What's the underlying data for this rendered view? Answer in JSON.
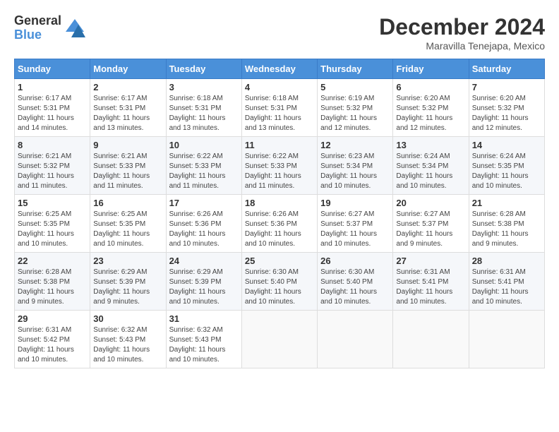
{
  "logo": {
    "general": "General",
    "blue": "Blue"
  },
  "title": {
    "month_year": "December 2024",
    "location": "Maravilla Tenejapa, Mexico"
  },
  "weekdays": [
    "Sunday",
    "Monday",
    "Tuesday",
    "Wednesday",
    "Thursday",
    "Friday",
    "Saturday"
  ],
  "weeks": [
    [
      {
        "day": "1",
        "sunrise": "6:17 AM",
        "sunset": "5:31 PM",
        "daylight": "11 hours and 14 minutes."
      },
      {
        "day": "2",
        "sunrise": "6:17 AM",
        "sunset": "5:31 PM",
        "daylight": "11 hours and 13 minutes."
      },
      {
        "day": "3",
        "sunrise": "6:18 AM",
        "sunset": "5:31 PM",
        "daylight": "11 hours and 13 minutes."
      },
      {
        "day": "4",
        "sunrise": "6:18 AM",
        "sunset": "5:31 PM",
        "daylight": "11 hours and 13 minutes."
      },
      {
        "day": "5",
        "sunrise": "6:19 AM",
        "sunset": "5:32 PM",
        "daylight": "11 hours and 12 minutes."
      },
      {
        "day": "6",
        "sunrise": "6:20 AM",
        "sunset": "5:32 PM",
        "daylight": "11 hours and 12 minutes."
      },
      {
        "day": "7",
        "sunrise": "6:20 AM",
        "sunset": "5:32 PM",
        "daylight": "11 hours and 12 minutes."
      }
    ],
    [
      {
        "day": "8",
        "sunrise": "6:21 AM",
        "sunset": "5:32 PM",
        "daylight": "11 hours and 11 minutes."
      },
      {
        "day": "9",
        "sunrise": "6:21 AM",
        "sunset": "5:33 PM",
        "daylight": "11 hours and 11 minutes."
      },
      {
        "day": "10",
        "sunrise": "6:22 AM",
        "sunset": "5:33 PM",
        "daylight": "11 hours and 11 minutes."
      },
      {
        "day": "11",
        "sunrise": "6:22 AM",
        "sunset": "5:33 PM",
        "daylight": "11 hours and 11 minutes."
      },
      {
        "day": "12",
        "sunrise": "6:23 AM",
        "sunset": "5:34 PM",
        "daylight": "11 hours and 10 minutes."
      },
      {
        "day": "13",
        "sunrise": "6:24 AM",
        "sunset": "5:34 PM",
        "daylight": "11 hours and 10 minutes."
      },
      {
        "day": "14",
        "sunrise": "6:24 AM",
        "sunset": "5:35 PM",
        "daylight": "11 hours and 10 minutes."
      }
    ],
    [
      {
        "day": "15",
        "sunrise": "6:25 AM",
        "sunset": "5:35 PM",
        "daylight": "11 hours and 10 minutes."
      },
      {
        "day": "16",
        "sunrise": "6:25 AM",
        "sunset": "5:35 PM",
        "daylight": "11 hours and 10 minutes."
      },
      {
        "day": "17",
        "sunrise": "6:26 AM",
        "sunset": "5:36 PM",
        "daylight": "11 hours and 10 minutes."
      },
      {
        "day": "18",
        "sunrise": "6:26 AM",
        "sunset": "5:36 PM",
        "daylight": "11 hours and 10 minutes."
      },
      {
        "day": "19",
        "sunrise": "6:27 AM",
        "sunset": "5:37 PM",
        "daylight": "11 hours and 10 minutes."
      },
      {
        "day": "20",
        "sunrise": "6:27 AM",
        "sunset": "5:37 PM",
        "daylight": "11 hours and 9 minutes."
      },
      {
        "day": "21",
        "sunrise": "6:28 AM",
        "sunset": "5:38 PM",
        "daylight": "11 hours and 9 minutes."
      }
    ],
    [
      {
        "day": "22",
        "sunrise": "6:28 AM",
        "sunset": "5:38 PM",
        "daylight": "11 hours and 9 minutes."
      },
      {
        "day": "23",
        "sunrise": "6:29 AM",
        "sunset": "5:39 PM",
        "daylight": "11 hours and 9 minutes."
      },
      {
        "day": "24",
        "sunrise": "6:29 AM",
        "sunset": "5:39 PM",
        "daylight": "11 hours and 10 minutes."
      },
      {
        "day": "25",
        "sunrise": "6:30 AM",
        "sunset": "5:40 PM",
        "daylight": "11 hours and 10 minutes."
      },
      {
        "day": "26",
        "sunrise": "6:30 AM",
        "sunset": "5:40 PM",
        "daylight": "11 hours and 10 minutes."
      },
      {
        "day": "27",
        "sunrise": "6:31 AM",
        "sunset": "5:41 PM",
        "daylight": "11 hours and 10 minutes."
      },
      {
        "day": "28",
        "sunrise": "6:31 AM",
        "sunset": "5:41 PM",
        "daylight": "11 hours and 10 minutes."
      }
    ],
    [
      {
        "day": "29",
        "sunrise": "6:31 AM",
        "sunset": "5:42 PM",
        "daylight": "11 hours and 10 minutes."
      },
      {
        "day": "30",
        "sunrise": "6:32 AM",
        "sunset": "5:43 PM",
        "daylight": "11 hours and 10 minutes."
      },
      {
        "day": "31",
        "sunrise": "6:32 AM",
        "sunset": "5:43 PM",
        "daylight": "11 hours and 10 minutes."
      },
      null,
      null,
      null,
      null
    ]
  ]
}
